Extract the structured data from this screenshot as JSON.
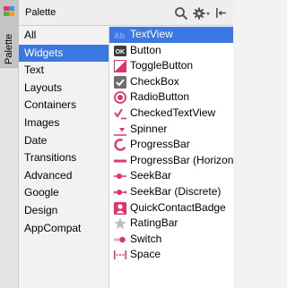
{
  "side_tab": {
    "label": "Palette"
  },
  "header": {
    "title": "Palette"
  },
  "categories": [
    "All",
    "Widgets",
    "Text",
    "Layouts",
    "Containers",
    "Images",
    "Date",
    "Transitions",
    "Advanced",
    "Google",
    "Design",
    "AppCompat"
  ],
  "selected_category": "Widgets",
  "widgets": [
    {
      "label": "TextView",
      "icon": "textview-icon"
    },
    {
      "label": "Button",
      "icon": "button-icon"
    },
    {
      "label": "ToggleButton",
      "icon": "togglebutton-icon"
    },
    {
      "label": "CheckBox",
      "icon": "checkbox-icon"
    },
    {
      "label": "RadioButton",
      "icon": "radiobutton-icon"
    },
    {
      "label": "CheckedTextView",
      "icon": "checkedtextview-icon"
    },
    {
      "label": "Spinner",
      "icon": "spinner-icon"
    },
    {
      "label": "ProgressBar",
      "icon": "progressbar-circle-icon"
    },
    {
      "label": "ProgressBar (Horizontal)",
      "icon": "progressbar-horizontal-icon"
    },
    {
      "label": "SeekBar",
      "icon": "seekbar-icon"
    },
    {
      "label": "SeekBar (Discrete)",
      "icon": "seekbar-discrete-icon"
    },
    {
      "label": "QuickContactBadge",
      "icon": "quickcontactbadge-icon"
    },
    {
      "label": "RatingBar",
      "icon": "ratingbar-icon"
    },
    {
      "label": "Switch",
      "icon": "switch-icon"
    },
    {
      "label": "Space",
      "icon": "space-icon"
    }
  ],
  "selected_widget": "TextView",
  "colors": {
    "accent_pink": "#e0336e",
    "selection_blue": "#3b78e3",
    "icon_gray": "#6e6e6e"
  }
}
